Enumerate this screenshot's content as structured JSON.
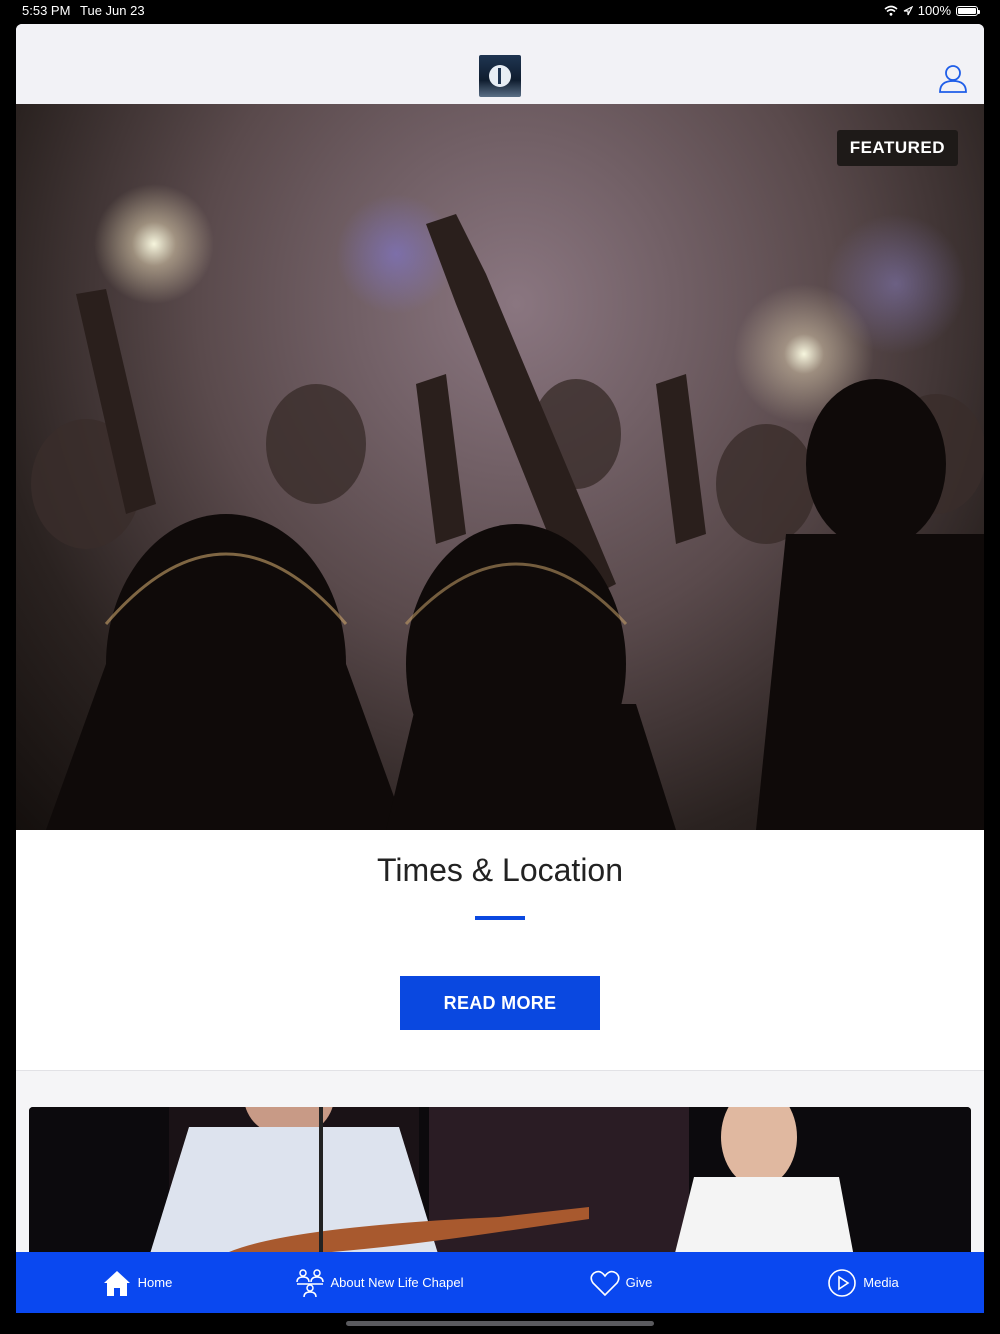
{
  "status_bar": {
    "time": "5:53 PM",
    "date": "Tue Jun 23",
    "battery": "100%"
  },
  "nav": {
    "logo_icon": "church-logo-icon",
    "profile_icon": "user-icon"
  },
  "hero": {
    "badge": "FEATURED"
  },
  "card": {
    "title": "Times & Location",
    "button": "READ MORE"
  },
  "tabs": [
    {
      "label": "Home",
      "icon": "home-icon"
    },
    {
      "label": "About New Life Chapel",
      "icon": "people-icon"
    },
    {
      "label": "Give",
      "icon": "heart-icon"
    },
    {
      "label": "Media",
      "icon": "play-icon"
    }
  ],
  "colors": {
    "accent": "#0a48f0",
    "button": "#0a48e0",
    "badge_bg": "#1e1a18"
  }
}
